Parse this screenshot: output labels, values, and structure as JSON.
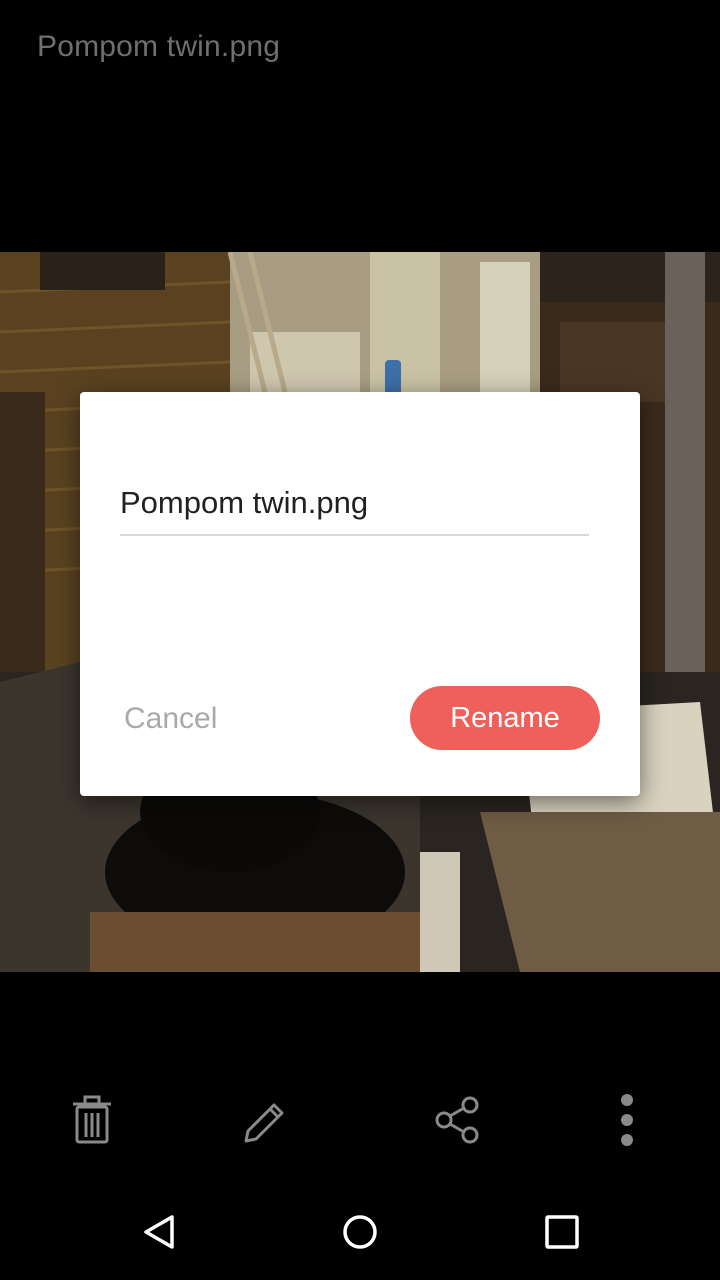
{
  "header": {
    "file_name": "Pompom twin.png"
  },
  "photo": {
    "description_icon": "photo-image"
  },
  "rename_dialog": {
    "input_value": "Pompom twin.png",
    "cancel_label": "Cancel",
    "rename_label": "Rename",
    "accent_color": "#f0605a"
  },
  "action_bar": {
    "icons": [
      "trash-icon",
      "pencil-icon",
      "share-icon",
      "more-vert-icon"
    ]
  },
  "nav_bar": {
    "icons": [
      "back-icon",
      "home-icon",
      "recents-icon"
    ]
  }
}
